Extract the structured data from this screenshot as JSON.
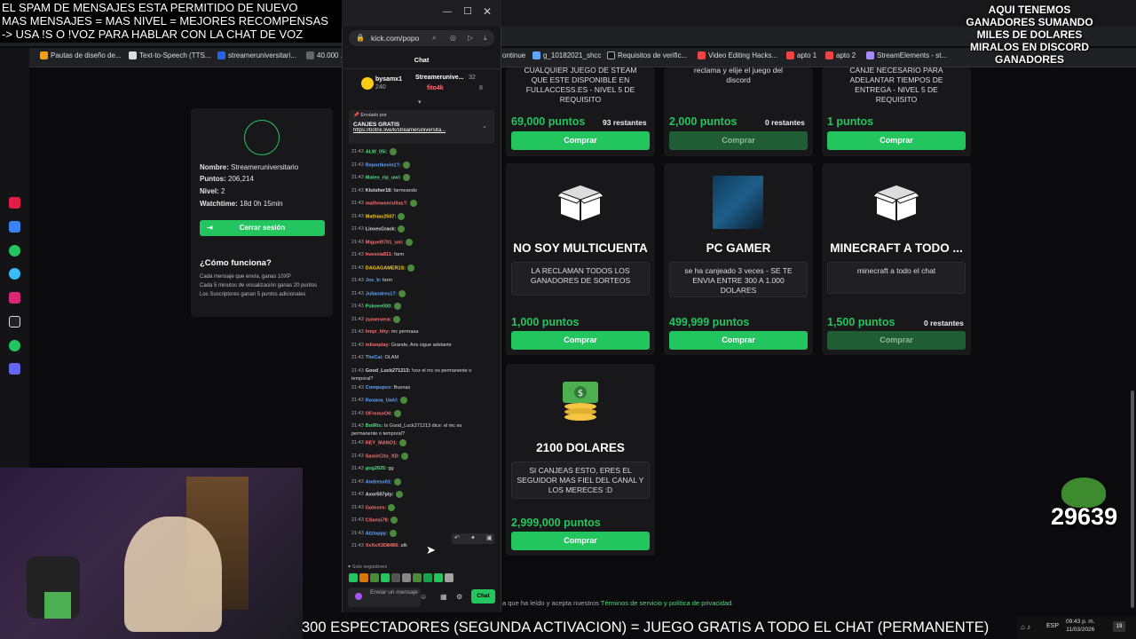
{
  "banner": {
    "line1": "EL SPAM DE MENSAJES ESTA PERMITIDO DE NUEVO",
    "line2": "MAS MENSAJES = MAS NIVEL = MEJORES RECOMPENSAS",
    "line3": "-> USA !S O !VOZ PARA HABLAR CON LA CHAT DE VOZ"
  },
  "overlay_right": {
    "line1": "AQUI TENEMOS",
    "line2": "GANADORES SUMANDO",
    "line3": "MILES DE DOLARES",
    "line4": "MIRALOS EN DISCORD",
    "line5": "GANADORES"
  },
  "bookmarks": {
    "b1": "Pautas de diseño de...",
    "b2": "Text-to-Speech (TTS...",
    "b3": "streameruniversitari...",
    "b4": "40.000 ...",
    "b5": "ontinue",
    "b6": "g_10182021_shcc",
    "b7": "Requisitos de verific...",
    "b8": "Video Editing Hacks...",
    "b9": "apto 1",
    "b10": "apto 2",
    "b11": "StreamElements - st..."
  },
  "profile": {
    "name_label": "Nombre:",
    "name_value": "Streameruniversitario",
    "points_label": "Puntos:",
    "points_value": "206,214",
    "level_label": "Nivel:",
    "level_value": "2",
    "watch_label": "Watchtime:",
    "watch_value": "18d 0h 15min",
    "logout": "Cerrar sesión",
    "howto_title": "¿Cómo funciona?",
    "howto_1": "Cada mensaje que envía, ganas 10XP",
    "howto_2": "Cada 5 minutos de visualización ganas 20 puntos",
    "howto_3": "Los Suscriptores ganan 5 puntos adicionales"
  },
  "products": {
    "top1_desc1": "CUALQUIER JUEGO DE STEAM",
    "top1_desc2": "QUE ESTE DISPONIBLE EN",
    "top1_desc3": "FULLACCESS.ES - NIVEL 5 DE",
    "top1_desc4": "REQUISITO",
    "top1_price": "69,000 puntos",
    "top1_remain": "93 restantes",
    "top2_desc1": "reclama y elije el juego del",
    "top2_desc2": "discord",
    "top2_price": "2,000 puntos",
    "top2_remain": "0 restantes",
    "top3_desc1": "CANJE NECESARIO PARA",
    "top3_desc2": "ADELANTAR TIEMPOS DE",
    "top3_desc3": "ENTREGA - NIVEL 5 DE",
    "top3_desc4": "REQUISITO",
    "top3_price": "1 puntos",
    "buy": "Comprar",
    "p1_title": "NO SOY MULTICUENTA",
    "p1_desc": "LA RECLAMAN TODOS LOS GANADORES DE SORTEOS",
    "p1_price": "1,000 puntos",
    "p2_title": "PC GAMER",
    "p2_desc": "se ha canjeado 3 veces - SE TE ENVIA ENTRE 300 A 1.000 DOLARES",
    "p2_price": "499,999 puntos",
    "p3_title": "MINECRAFT A TODO ...",
    "p3_desc": "minecraft a todo el chat",
    "p3_price": "1,500 puntos",
    "p3_remain": "0 restantes",
    "p4_title": "2100 DOLARES",
    "p4_desc": "SI CANJEAS ESTO, ERES EL SEGUIDOR MAS FIEL DEL CANAL Y LOS MERECES :D",
    "p4_price": "2,999,000 puntos"
  },
  "chat": {
    "url": "kick.com/popo",
    "header": "Chat",
    "leader1_name": "bysamx1",
    "leader1_pts": "240",
    "leader2_name": "Streamerunive...",
    "leader2_pts": "32",
    "leader3_name": "fito4k",
    "leader3_pts": "8",
    "pinned_by": "Enviado por",
    "pinned_title": "CANJES GRATIS",
    "pinned_link": "https://botrix.live/k/streameruniversita...",
    "followers": "Solo seguidores",
    "input_placeholder": "Enviar un mensaje",
    "send": "Chat"
  },
  "messages": [
    {
      "t": "21:43",
      "u": "ALW_05i",
      "c": "#4ade80",
      "m": ""
    },
    {
      "t": "21:43",
      "u": "Reportkevin1?",
      "c": "#60a5fa",
      "m": ""
    },
    {
      "t": "21:43",
      "u": "Mateo_rip_uwi",
      "c": "#4ade80",
      "m": ""
    },
    {
      "t": "21:43",
      "u": "Klutsher18",
      "c": "#ddd",
      "m": "farmeando"
    },
    {
      "t": "21:43",
      "u": "mathewoerxillas?",
      "c": "#f87171",
      "m": ""
    },
    {
      "t": "21:43",
      "u": "Mathias2507",
      "c": "#facc15",
      "m": ""
    },
    {
      "t": "21:43",
      "u": "LinxesCrack",
      "c": "#ddd",
      "m": ""
    },
    {
      "t": "21:43",
      "u": "Miguel0701_uni",
      "c": "#f87171",
      "m": ""
    },
    {
      "t": "21:43",
      "u": "hvessia811",
      "c": "#f87171",
      "m": "farm"
    },
    {
      "t": "21:43",
      "u": "DAGAGAMER1S",
      "c": "#facc15",
      "m": ""
    },
    {
      "t": "21:43",
      "u": "Jos_b",
      "c": "#60a5fa",
      "m": "farm"
    },
    {
      "t": "21:43",
      "u": "Juliandres17",
      "c": "#60a5fa",
      "m": ""
    },
    {
      "t": "21:43",
      "u": "Pokeee000",
      "c": "#4ade80",
      "m": ""
    },
    {
      "t": "21:43",
      "u": "zumervera",
      "c": "#f87171",
      "m": ""
    },
    {
      "t": "21:43",
      "u": "lmqx_hhy",
      "c": "#f87171",
      "m": "mc permaaa"
    },
    {
      "t": "21:43",
      "u": "mlionplay",
      "c": "#f87171",
      "m": "Grande, Aris sigue adelante"
    },
    {
      "t": "21:43",
      "u": "TheCai",
      "c": "#60a5fa",
      "m": "OLAM"
    },
    {
      "t": "21:43",
      "u": "Good_Luck271213",
      "c": "#ddd",
      "m": "!voz el mc es permanente o temporal?"
    },
    {
      "t": "21:43",
      "u": "Compupcs",
      "c": "#60a5fa",
      "m": "Buenas"
    },
    {
      "t": "21:43",
      "u": "Roxana_UwU",
      "c": "#60a5fa",
      "m": ""
    },
    {
      "t": "21:43",
      "u": "OFremoO0",
      "c": "#f87171",
      "m": ""
    },
    {
      "t": "21:43",
      "u": "BotRix",
      "c": "#4ade80",
      "m": "Is Good_Luck271213 dice: el mc es permanente o temporal?"
    },
    {
      "t": "21:43",
      "u": "REY_MANO1",
      "c": "#f87171",
      "m": ""
    },
    {
      "t": "21:43",
      "u": "SamirCito_XD",
      "c": "#f87171",
      "m": ""
    },
    {
      "t": "21:43",
      "u": "gog2025",
      "c": "#4ade80",
      "m": "gg"
    },
    {
      "t": "21:43",
      "u": "Andresx01",
      "c": "#60a5fa",
      "m": ""
    },
    {
      "t": "21:43",
      "u": "Axor507pty",
      "c": "#ddd",
      "m": ""
    },
    {
      "t": "21:43",
      "u": "Gatoxes",
      "c": "#f87171",
      "m": ""
    },
    {
      "t": "21:43",
      "u": "CSansi78",
      "c": "#f87171",
      "m": ""
    },
    {
      "t": "21:43",
      "u": "Atzloppy",
      "c": "#60a5fa",
      "m": ""
    },
    {
      "t": "21:43",
      "u": "XxXxX3D8489",
      "c": "#f87171",
      "m": "afk"
    }
  ],
  "footer": {
    "terms_prefix": "a que ha leído y acepta nuestros",
    "terms_link": "Términos de servicio y política de privacidad.",
    "ticker": "300 ESPECTADORES (SEGUNDA ACTIVACION) = JUEGO GRATIS A TODO EL CHAT (PERMANENTE)",
    "counter": "29639",
    "lang": "ESP",
    "time": "09:43 p. m.",
    "date": "11/03/2026"
  },
  "colors": {
    "accent": "#22c55e",
    "bg": "#0b0b0d",
    "card": "#18181b"
  }
}
